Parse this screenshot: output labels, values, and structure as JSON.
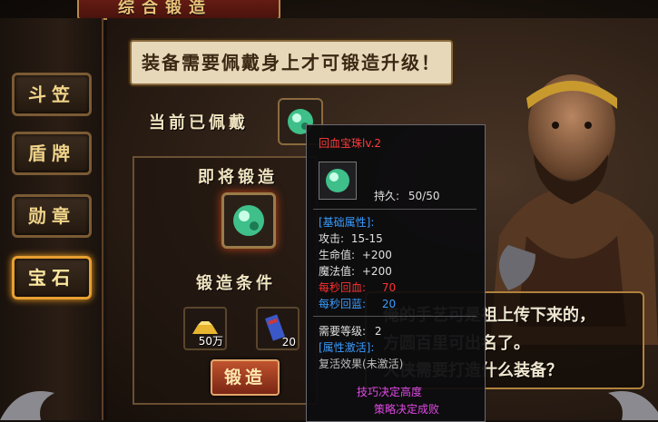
{
  "window": {
    "title": "综合锻造"
  },
  "menu": [
    {
      "label": "斗笠",
      "active": false
    },
    {
      "label": "盾牌",
      "active": false
    },
    {
      "label": "勋章",
      "active": false
    },
    {
      "label": "宝石",
      "active": true
    }
  ],
  "notice": "装备需要佩戴身上才可锻造升级！",
  "equipped": {
    "label": "当前已佩戴"
  },
  "forge": {
    "upcoming_label": "即将锻造",
    "conditions_label": "锻造条件",
    "button_label": "锻造",
    "materials": [
      {
        "icon": "gold-ingot-icon",
        "count": "50万"
      },
      {
        "icon": "scroll-item-icon",
        "count": "20"
      }
    ]
  },
  "npc": {
    "speech": [
      "俺的手艺可是祖上传下来的，",
      "方圆百里可出名了。",
      "大侠需要打造什么装备？"
    ]
  },
  "tooltip": {
    "title": "回血宝珠lv.2",
    "durability_label": "持久:",
    "durability": "50/50",
    "base_header": "[基础属性]:",
    "attack_label": "攻击:",
    "attack": "15-15",
    "hp_label": "生命值:",
    "hp": "+200",
    "mp_label": "魔法值:",
    "mp": "+200",
    "hp_regen_label": "每秒回血:",
    "hp_regen": "70",
    "mp_regen_label": "每秒回蓝:",
    "mp_regen": "20",
    "req_level_label": "需要等级:",
    "req_level": "2",
    "activate_header": "[属性激活]:",
    "revive_effect": "复活效果(未激活)",
    "footer_1": "技巧决定高度",
    "footer_2": "策略决定成败"
  },
  "colors": {
    "accent_gold": "#e8c27a",
    "active_border": "#e8a032",
    "tooltip_red": "#ff3030",
    "tooltip_blue": "#3a9cff",
    "tooltip_magenta": "#e14ae6"
  }
}
